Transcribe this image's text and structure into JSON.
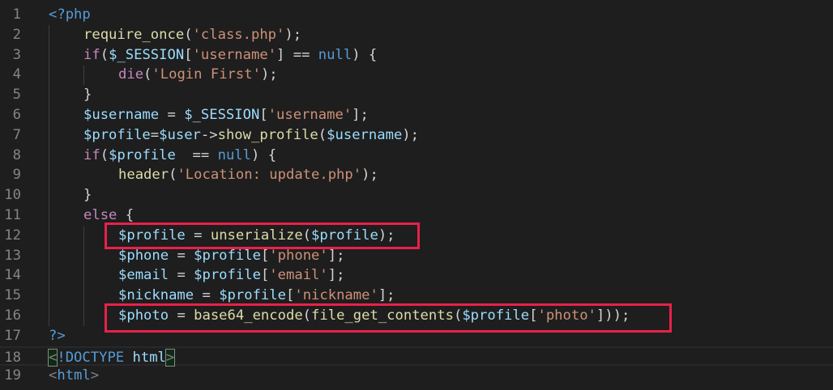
{
  "lines": [
    {
      "n": "1",
      "ind": 0,
      "tokens": [
        [
          "t",
          "<?php"
        ]
      ]
    },
    {
      "n": "2",
      "ind": 1,
      "tokens": [
        [
          "f",
          "require_once"
        ],
        [
          "p",
          "("
        ],
        [
          "s",
          "'class.php'"
        ],
        [
          "p",
          ");"
        ]
      ]
    },
    {
      "n": "3",
      "ind": 1,
      "tokens": [
        [
          "k",
          "if"
        ],
        [
          "p",
          "("
        ],
        [
          "v",
          "$_SESSION"
        ],
        [
          "p",
          "["
        ],
        [
          "s",
          "'username'"
        ],
        [
          "p",
          "] == "
        ],
        [
          "n",
          "null"
        ],
        [
          "p",
          ") {"
        ]
      ]
    },
    {
      "n": "4",
      "ind": 2,
      "tokens": [
        [
          "k",
          "die"
        ],
        [
          "p",
          "("
        ],
        [
          "s",
          "'Login First'"
        ],
        [
          "p",
          ");"
        ]
      ]
    },
    {
      "n": "5",
      "ind": 1,
      "tokens": [
        [
          "p",
          "}"
        ]
      ]
    },
    {
      "n": "6",
      "ind": 1,
      "tokens": [
        [
          "v",
          "$username"
        ],
        [
          "p",
          " = "
        ],
        [
          "v",
          "$_SESSION"
        ],
        [
          "p",
          "["
        ],
        [
          "s",
          "'username'"
        ],
        [
          "p",
          "];"
        ]
      ]
    },
    {
      "n": "7",
      "ind": 1,
      "tokens": [
        [
          "v",
          "$profile"
        ],
        [
          "p",
          "="
        ],
        [
          "v",
          "$user"
        ],
        [
          "p",
          "->"
        ],
        [
          "f",
          "show_profile"
        ],
        [
          "p",
          "("
        ],
        [
          "v",
          "$username"
        ],
        [
          "p",
          ");"
        ]
      ]
    },
    {
      "n": "8",
      "ind": 1,
      "tokens": [
        [
          "k",
          "if"
        ],
        [
          "p",
          "("
        ],
        [
          "v",
          "$profile"
        ],
        [
          "p",
          "  == "
        ],
        [
          "n",
          "null"
        ],
        [
          "p",
          ") {"
        ]
      ]
    },
    {
      "n": "9",
      "ind": 2,
      "tokens": [
        [
          "f",
          "header"
        ],
        [
          "p",
          "("
        ],
        [
          "s",
          "'Location: update.php'"
        ],
        [
          "p",
          ");"
        ]
      ]
    },
    {
      "n": "10",
      "ind": 1,
      "tokens": [
        [
          "p",
          "}"
        ]
      ]
    },
    {
      "n": "11",
      "ind": 1,
      "tokens": [
        [
          "k",
          "else"
        ],
        [
          "p",
          " {"
        ]
      ]
    },
    {
      "n": "12",
      "ind": 2,
      "tokens": [
        [
          "v",
          "$profile"
        ],
        [
          "p",
          " = "
        ],
        [
          "f",
          "unserialize"
        ],
        [
          "p",
          "("
        ],
        [
          "v",
          "$profile"
        ],
        [
          "p",
          ");"
        ]
      ]
    },
    {
      "n": "13",
      "ind": 2,
      "tokens": [
        [
          "v",
          "$phone"
        ],
        [
          "p",
          " = "
        ],
        [
          "v",
          "$profile"
        ],
        [
          "p",
          "["
        ],
        [
          "s",
          "'phone'"
        ],
        [
          "p",
          "];"
        ]
      ]
    },
    {
      "n": "14",
      "ind": 2,
      "tokens": [
        [
          "v",
          "$email"
        ],
        [
          "p",
          " = "
        ],
        [
          "v",
          "$profile"
        ],
        [
          "p",
          "["
        ],
        [
          "s",
          "'email'"
        ],
        [
          "p",
          "];"
        ]
      ]
    },
    {
      "n": "15",
      "ind": 2,
      "tokens": [
        [
          "v",
          "$nickname"
        ],
        [
          "p",
          " = "
        ],
        [
          "v",
          "$profile"
        ],
        [
          "p",
          "["
        ],
        [
          "s",
          "'nickname'"
        ],
        [
          "p",
          "];"
        ]
      ]
    },
    {
      "n": "16",
      "ind": 2,
      "tokens": [
        [
          "v",
          "$photo"
        ],
        [
          "p",
          " = "
        ],
        [
          "f",
          "base64_encode"
        ],
        [
          "p",
          "("
        ],
        [
          "f",
          "file_get_contents"
        ],
        [
          "p",
          "("
        ],
        [
          "v",
          "$profile"
        ],
        [
          "p",
          "["
        ],
        [
          "s",
          "'photo'"
        ],
        [
          "p",
          "]));"
        ]
      ]
    },
    {
      "n": "17",
      "ind": 0,
      "tokens": [
        [
          "t",
          "?>"
        ]
      ]
    },
    {
      "n": "18",
      "ind": 0,
      "current": true,
      "tokens": [
        [
          "bm h",
          "<"
        ],
        [
          "t",
          "!DOCTYPE"
        ],
        [
          "p",
          " "
        ],
        [
          "v",
          "html"
        ],
        [
          "bm h",
          ">"
        ]
      ]
    },
    {
      "n": "19",
      "ind": 0,
      "tokens": [
        [
          "h",
          "<"
        ],
        [
          "t",
          "html"
        ],
        [
          "h",
          ">"
        ]
      ]
    }
  ],
  "colors": {
    "highlight": "#e8214a",
    "background": "#1e1e1e"
  }
}
